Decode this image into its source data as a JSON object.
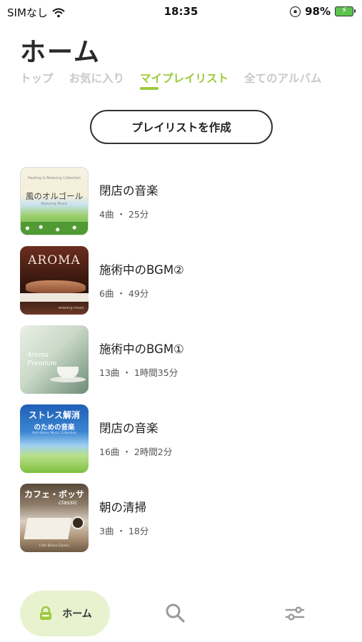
{
  "status_bar": {
    "carrier": "SIMなし",
    "time": "18:35",
    "battery_percent": "98%",
    "icons": [
      "wifi-icon",
      "orientation-lock-icon",
      "battery-charging-icon"
    ]
  },
  "header": {
    "title": "ホーム"
  },
  "tabs": [
    {
      "label": "トップ"
    },
    {
      "label": "お気に入り"
    },
    {
      "label": "マイプレイリスト"
    },
    {
      "label": "全てのアルバム"
    }
  ],
  "active_tab_index": 2,
  "create_playlist_label": "プレイリストを作成",
  "playlists": [
    {
      "title": "閉店の音楽",
      "meta": "4曲 ・ 25分",
      "cover": {
        "line1": "Healing & Relaxing Collection",
        "line2": "風のオルゴール",
        "line3": "Relaxing Music"
      }
    },
    {
      "title": "施術中のBGM②",
      "meta": "6曲 ・ 49分",
      "cover": {
        "line1": "AROMA",
        "line2": "relaxing music"
      }
    },
    {
      "title": "施術中のBGM①",
      "meta": "13曲 ・ 1時間35分",
      "cover": {
        "line1": "Aroma",
        "line2": "Premium"
      }
    },
    {
      "title": "閉店の音楽",
      "meta": "16曲 ・ 2時間2分",
      "cover": {
        "line1": "ストレス解消",
        "line2": "のための音楽",
        "line3": "Anti-Stress Music Collection"
      }
    },
    {
      "title": "朝の清掃",
      "meta": "3曲 ・ 18分",
      "cover": {
        "line1": "カフェ・ボッサ",
        "line2": "classic",
        "line3": "Cafe Bossa Classic"
      }
    }
  ],
  "bottom_nav": {
    "home_label": "ホーム",
    "icons": [
      "home-icon",
      "search-icon",
      "settings-sliders-icon"
    ]
  },
  "colors": {
    "accent": "#9ccb3c",
    "nav_active_bg": "#e9f2cf",
    "inactive_tab": "#c9c9c9"
  }
}
